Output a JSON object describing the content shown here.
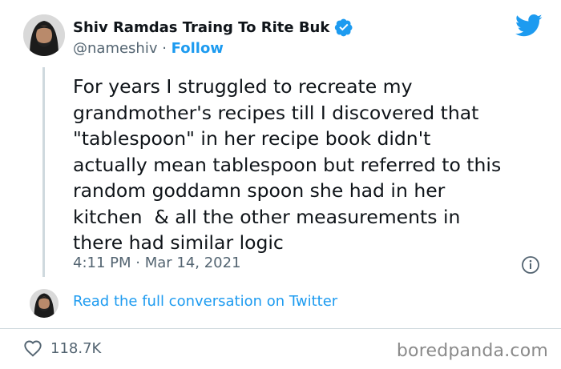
{
  "tweet": {
    "display_name": "Shiv Ramdas Traing To Rite Buk",
    "handle": "@nameshiv",
    "separator": " · ",
    "follow_label": "Follow",
    "text": "For years I struggled to recreate my\ngrandmother's recipes till I discovered that\n\"tablespoon\" in her recipe book didn't\nactually mean tablespoon but referred to this\nrandom goddamn spoon she had in her\nkitchen  & all the other measurements in\nthere had similar logic",
    "time": "4:11 PM",
    "date": "Mar 14, 2021",
    "read_more": "Read the full conversation on Twitter",
    "like_count": "118.7K"
  },
  "watermark": "boredpanda.com",
  "icons": {
    "verified": "verified-badge-icon",
    "bird": "twitter-bird-icon",
    "info": "info-icon",
    "heart": "heart-icon"
  },
  "colors": {
    "accent": "#1d9bf0",
    "text": "#0f1419",
    "muted": "#536471",
    "divider": "#cfd9de"
  }
}
